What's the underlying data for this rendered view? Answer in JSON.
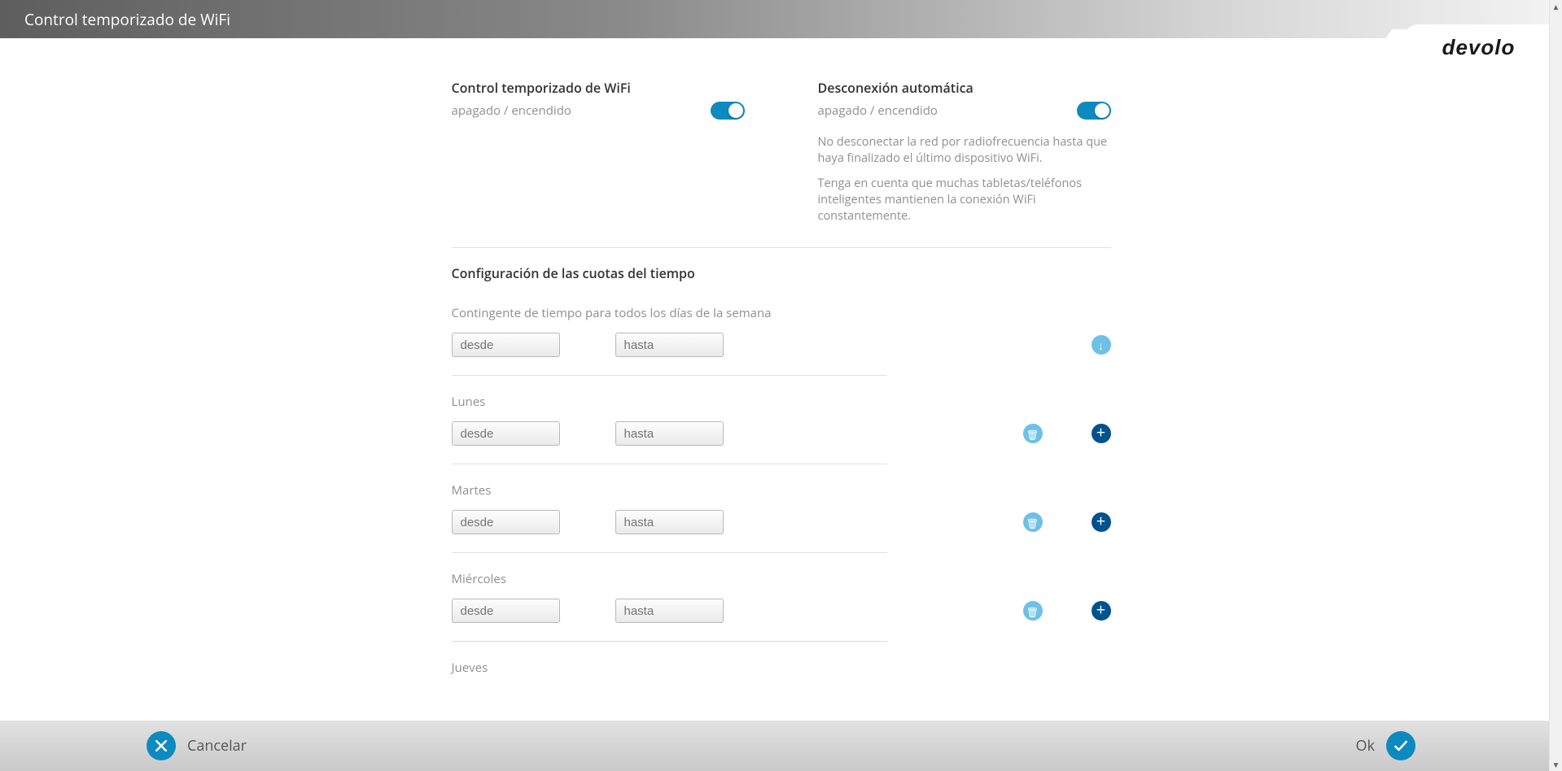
{
  "header": {
    "title": "Control temporizado de WiFi"
  },
  "brand": "devolo",
  "wifi_control": {
    "title": "Control temporizado de WiFi",
    "subtitle": "apagado / encendido"
  },
  "auto_disconnect": {
    "title": "Desconexión automática",
    "subtitle": "apagado / encendido",
    "desc1": "No desconectar la red por radiofrecuencia hasta que haya finalizado el último dispositivo WiFi.",
    "desc2": "Tenga en cuenta que muchas tabletas/teléfonos inteligentes mantienen la conexión WiFi constantemente."
  },
  "quota": {
    "title": "Configuración de las cuotas del tiempo",
    "all_days_label": "Contingente de tiempo para todos los días de la semana",
    "from": "desde",
    "to": "hasta",
    "days": [
      "Lunes",
      "Martes",
      "Miércoles",
      "Jueves"
    ]
  },
  "footer": {
    "cancel": "Cancelar",
    "ok": "Ok"
  }
}
